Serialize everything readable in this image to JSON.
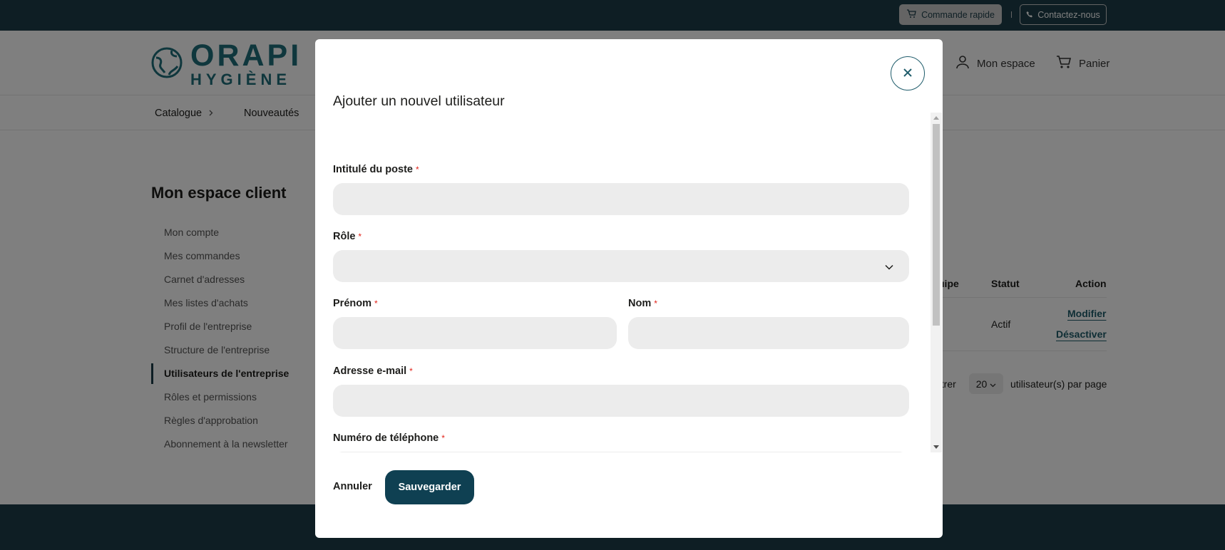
{
  "topbar": {
    "quick_order_label": "Commande rapide",
    "contact_label": "Contactez-nous",
    "bg_color": "#1c3d48"
  },
  "header": {
    "logo_main": "ORAPI",
    "logo_sub": "HYGIÈNE",
    "account_label": "Mon espace",
    "cart_label": "Panier",
    "brand_color": "#1f6e7a"
  },
  "nav": {
    "items": [
      {
        "label": "Catalogue"
      },
      {
        "label": "Nouveautés"
      }
    ]
  },
  "page": {
    "title": "Mon espace client",
    "sidebar": [
      {
        "label": "Mon compte"
      },
      {
        "label": "Mes commandes"
      },
      {
        "label": "Carnet d'adresses"
      },
      {
        "label": "Mes listes d'achats"
      },
      {
        "label": "Profil de l'entreprise"
      },
      {
        "label": "Structure de l'entreprise"
      },
      {
        "label": "Utilisateurs de l'entreprise"
      },
      {
        "label": "Rôles et permissions"
      },
      {
        "label": "Règles d'approbation"
      },
      {
        "label": "Abonnement à la newsletter"
      }
    ],
    "active_sidebar_index": 6,
    "table": {
      "headers": {
        "team": "uipe",
        "status": "Statut",
        "action": "Action"
      },
      "rows": [
        {
          "status": "Actif",
          "edit_label": "Modifier",
          "deactivate_label": "Désactiver"
        }
      ]
    },
    "pagination": {
      "show_label": "ntrer",
      "per_page_value": "20",
      "per_page_suffix": "utilisateur(s) par page"
    }
  },
  "modal": {
    "title": "Ajouter un nouvel utilisateur",
    "required_mark": "*",
    "fields": {
      "job_title": {
        "label": "Intitulé du poste",
        "value": ""
      },
      "role": {
        "label": "Rôle",
        "value": ""
      },
      "first_name": {
        "label": "Prénom",
        "value": ""
      },
      "last_name": {
        "label": "Nom",
        "value": ""
      },
      "email": {
        "label": "Adresse e-mail",
        "value": ""
      },
      "phone": {
        "label": "Numéro de téléphone",
        "value": ""
      }
    },
    "cancel_label": "Annuler",
    "save_label": "Sauvegarder",
    "accent_color": "#0f4052",
    "required_color": "#e2231a"
  },
  "icons": {
    "cart": "cart-icon",
    "phone": "phone-icon",
    "user": "user-icon",
    "close": "close-icon",
    "chevron": "chevron-down-icon"
  }
}
